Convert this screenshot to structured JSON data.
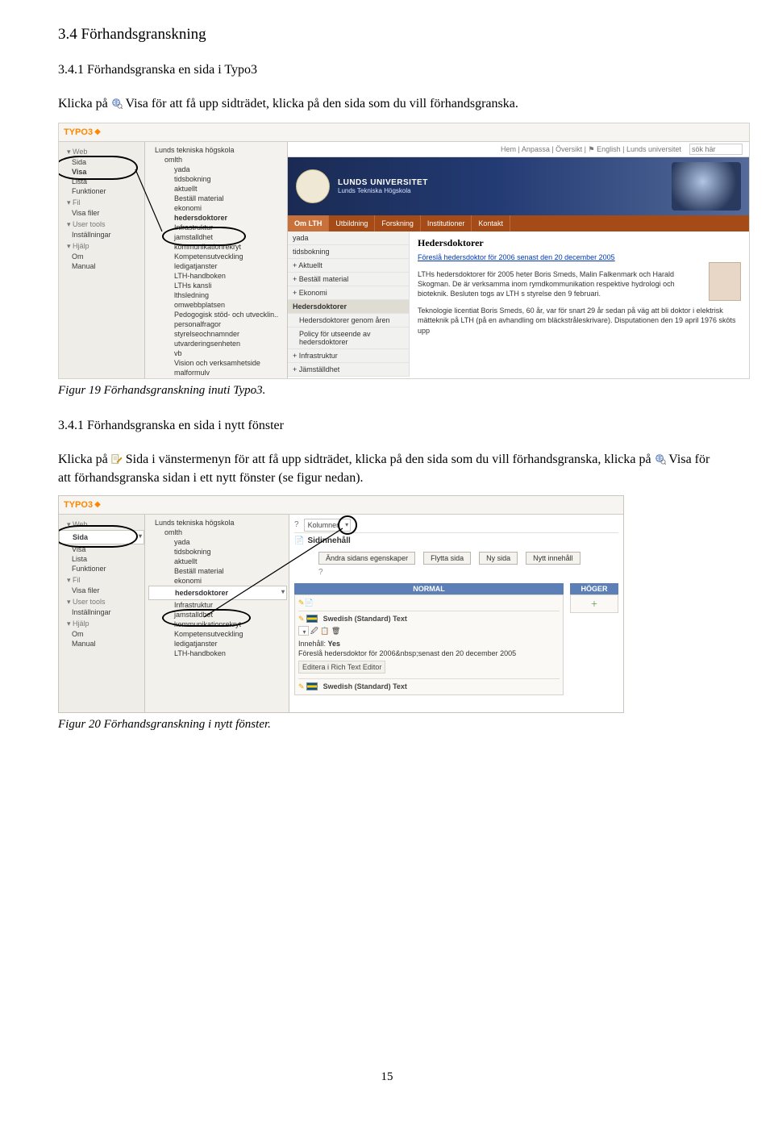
{
  "doc": {
    "h1": "3.4 Förhandsgranskning",
    "h2a": "3.4.1 Förhandsgranska en sida i Typo3",
    "p1a": "Klicka på ",
    "p1b": " Visa för att få upp sidträdet, klicka på den sida som du vill förhandsgranska.",
    "figcap1": "Figur 19 Förhandsgranskning inuti Typo3.",
    "h2b": "3.4.1 Förhandsgranska en sida i nytt fönster",
    "p2a": "Klicka på ",
    "p2b": " Sida i vänstermenyn för att få upp sidträdet, klicka på den sida som du vill förhandsgranska, klicka på ",
    "p2c": " Visa för att förhandsgranska sidan i ett nytt fönster (se figur nedan).",
    "figcap2": "Figur 20 Förhandsgranskning i nytt fönster.",
    "pagenum": "15"
  },
  "ss1": {
    "brand": "TYPO3",
    "nav": {
      "group_web": "Web",
      "items_web": [
        "Sida",
        "Visa",
        "Lista",
        "Funktioner"
      ],
      "group_fil": "Fil",
      "items_fil": [
        "Visa filer"
      ],
      "group_user": "User tools",
      "items_user": [
        "Inställningar"
      ],
      "group_help": "Hjälp",
      "items_help": [
        "Om",
        "Manual"
      ]
    },
    "tree": [
      "Lunds tekniska högskola",
      "omlth",
      "yada",
      "tidsbokning",
      "aktuellt",
      "Beställ material",
      "ekonomi",
      "hedersdoktorer",
      "Infrastruktur",
      "jamstalldhet",
      "kommunikationrekryt",
      "Kompetensutveckling",
      "ledigatjanster",
      "LTH-handboken",
      "LTHs kansli",
      "lthsledning",
      "omwebbplatsen",
      "Pedogogisk stöd- och utvecklin..",
      "personalfragor",
      "styrelseochnamnder",
      "utvarderingsenheten",
      "vb",
      "Vision och verksamhetside",
      "malformulv"
    ],
    "preview": {
      "tool_links": "Hem | Anpassa | Översikt | ⚑ English | Lunds universitet",
      "search_ph": "sök här",
      "uni_name": "LUNDS UNIVERSITET",
      "uni_sub": "Lunds Tekniska Högskola",
      "tabs": [
        "Om LTH",
        "Utbildning",
        "Forskning",
        "Institutioner",
        "Kontakt"
      ],
      "submenu": [
        "yada",
        "tidsbokning",
        "Aktuellt",
        "Beställ material",
        "Ekonomi",
        "Hedersdoktorer",
        "Hedersdoktorer genom åren",
        "Policy för utseende av hedersdoktorer",
        "Infrastruktur",
        "Jämställdhet"
      ],
      "article_title": "Hedersdoktorer",
      "article_link": "Föreslå hedersdoktor för 2006 senast den 20 december 2005",
      "article_p1": "LTHs hedersdoktorer för 2005 heter Boris Smeds, Malin Falkenmark och Harald Skogman. De är verksamma inom rymdkommunikation respektive hydrologi och bioteknik. Besluten togs av LTH s styrelse den 9 februari.",
      "article_p2": "Teknologie licentiat Boris Smeds, 60 år, var för snart 29 år sedan på väg att bli doktor i elektrisk mätteknik på LTH (på en avhandling om bläckstråleskrivare). Disputationen den 19 april 1976 sköts upp"
    }
  },
  "ss2": {
    "brand": "TYPO3",
    "nav": {
      "group_web": "Web",
      "items_web": [
        "Sida",
        "Visa",
        "Lista",
        "Funktioner"
      ],
      "group_fil": "Fil",
      "items_fil": [
        "Visa filer"
      ],
      "group_user": "User tools",
      "items_user": [
        "Inställningar"
      ],
      "group_help": "Hjälp",
      "items_help": [
        "Om",
        "Manual"
      ]
    },
    "tree": [
      "Lunds tekniska högskola",
      "omlth",
      "yada",
      "tidsbokning",
      "aktuellt",
      "Beställ material",
      "ekonomi",
      "hedersdoktorer",
      "Infrastruktur",
      "jamstalldhet",
      "kommunikationrekryt",
      "Kompetensutveckling",
      "ledigatjanster",
      "LTH-handboken"
    ],
    "main": {
      "dropdown": "Kolumner",
      "sidinnehall": "Sidinnehåll",
      "buttons": [
        "Ändra sidans egenskaper",
        "Flytta sida",
        "Ny sida",
        "Nytt innehåll"
      ],
      "panel_normal": "NORMAL",
      "panel_hoger": "HÖGER",
      "rec_lang": "Swedish (Standard) Text",
      "rec_innehall_label": "Innehåll:",
      "rec_innehall_val": "Yes",
      "rec_line": "Föreslå hedersdoktor för 2006&nbsp;senast den 20 december 2005",
      "rec_edit": "Editera i Rich Text Editor",
      "rec_lang2": "Swedish (Standard) Text"
    }
  }
}
